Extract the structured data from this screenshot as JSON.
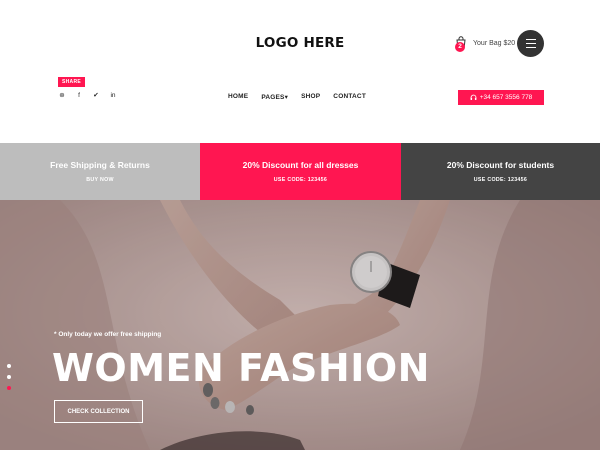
{
  "header": {
    "logo": "LOGO HERE",
    "bag": {
      "count": "2",
      "label": "Your Bag $20",
      "icon": "shopping-bag-icon"
    },
    "menu_icon": "hamburger-menu-icon",
    "share_label": "SHARE",
    "social": [
      {
        "icon": "pinterest-icon",
        "glyph": "⊛"
      },
      {
        "icon": "facebook-icon",
        "glyph": "f"
      },
      {
        "icon": "twitter-icon",
        "glyph": "✔"
      },
      {
        "icon": "linkedin-icon",
        "glyph": "in"
      }
    ],
    "nav": [
      "HOME",
      "PAGES",
      "SHOP",
      "CONTACT"
    ],
    "pages_caret": "▾",
    "phone": "+34 657 3556 778",
    "phone_icon": "headset-icon"
  },
  "promos": [
    {
      "title": "Free Shipping & Returns",
      "sub": "BUY NOW"
    },
    {
      "title": "20% Discount for all dresses",
      "sub": "USE CODE: 123456"
    },
    {
      "title": "20% Discount for students",
      "sub": "USE CODE: 123456"
    }
  ],
  "hero": {
    "note": "* Only today we offer free shipping",
    "title": "WOMEN FASHION",
    "button": "CHECK COLLECTION",
    "slides": 3,
    "active_slide": 3
  },
  "colors": {
    "accent": "#ff1651",
    "dark": "#444444",
    "grey": "#bdbdbd"
  }
}
